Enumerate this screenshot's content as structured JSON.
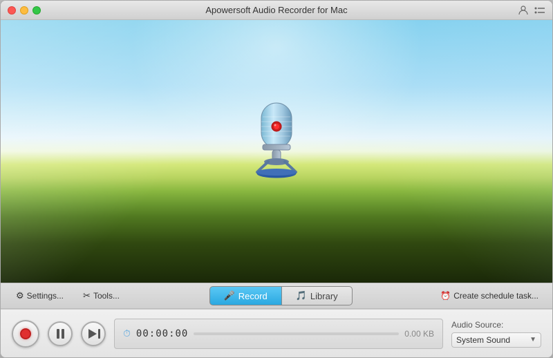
{
  "window": {
    "title": "Apowersoft Audio Recorder for Mac"
  },
  "toolbar": {
    "settings_label": "Settings...",
    "tools_label": "Tools...",
    "record_tab_label": "Record",
    "library_tab_label": "Library",
    "schedule_label": "Create schedule task..."
  },
  "controls": {
    "time_display": "00:00:00",
    "file_size": "0.00 KB"
  },
  "audio_source": {
    "label": "Audio Source:",
    "value": "System Sound"
  }
}
